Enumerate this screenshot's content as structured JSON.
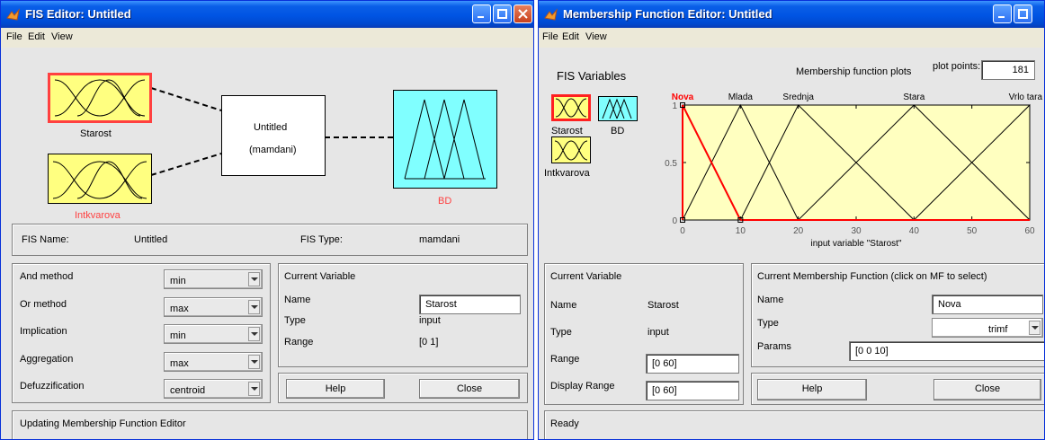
{
  "fis_editor": {
    "title": "FIS Editor: Untitled",
    "menu": [
      "File",
      "Edit",
      "View"
    ],
    "diagram": {
      "input1_label": "Starost",
      "input2_label": "Intkvarova",
      "system_name": "Untitled",
      "system_type": "(mamdani)",
      "output_label": "BD"
    },
    "info": {
      "fis_name_label": "FIS Name:",
      "fis_name_value": "Untitled",
      "fis_type_label": "FIS Type:",
      "fis_type_value": "mamdani"
    },
    "methods": [
      {
        "label": "And method",
        "value": "min"
      },
      {
        "label": "Or method",
        "value": "max"
      },
      {
        "label": "Implication",
        "value": "min"
      },
      {
        "label": "Aggregation",
        "value": "max"
      },
      {
        "label": "Defuzzification",
        "value": "centroid"
      }
    ],
    "current_variable": {
      "heading": "Current Variable",
      "name_label": "Name",
      "name_value": "Starost",
      "type_label": "Type",
      "type_value": "input",
      "range_label": "Range",
      "range_value": "[0 1]"
    },
    "help_label": "Help",
    "close_label": "Close",
    "status": "Updating Membership Function Editor"
  },
  "mf_editor": {
    "title": "Membership Function Editor: Untitled",
    "menu": [
      "File",
      "Edit",
      "View"
    ],
    "fis_variables_label": "FIS Variables",
    "variables": [
      "Starost",
      "BD",
      "Intkvarova"
    ],
    "plot_title": "Membership function plots",
    "plot_points_label": "plot points:",
    "plot_points_value": "181",
    "chart_data": {
      "type": "line",
      "xlabel": "input variable \"Starost\"",
      "xlim": [
        0,
        60
      ],
      "ylim": [
        0,
        1
      ],
      "x_ticks": [
        "0",
        "10",
        "20",
        "30",
        "40",
        "50",
        "60"
      ],
      "y_ticks": [
        "0",
        "0.5",
        "1"
      ],
      "series": [
        {
          "name": "Nova",
          "x": [
            0,
            0,
            10
          ],
          "y": [
            0,
            1,
            0
          ],
          "selected": true,
          "color": "#ff0000"
        },
        {
          "name": "Mlada",
          "x": [
            0,
            10,
            20
          ],
          "y": [
            0,
            1,
            0
          ],
          "color": "#000000"
        },
        {
          "name": "Srednja",
          "x": [
            10,
            20,
            40
          ],
          "y": [
            0,
            1,
            0
          ],
          "color": "#000000"
        },
        {
          "name": "Stara",
          "x": [
            20,
            40,
            60
          ],
          "y": [
            0,
            1,
            0
          ],
          "color": "#000000"
        },
        {
          "name": "Vrlo tara",
          "x": [
            40,
            60,
            60
          ],
          "y": [
            0,
            1,
            0
          ],
          "color": "#000000"
        }
      ],
      "label_x": [
        0,
        10,
        20,
        40,
        60
      ]
    },
    "current_variable": {
      "heading": "Current Variable",
      "name_label": "Name",
      "name_value": "Starost",
      "type_label": "Type",
      "type_value": "input",
      "range_label": "Range",
      "range_value": "[0 60]",
      "display_range_label": "Display Range",
      "display_range_value": "[0 60]"
    },
    "current_mf": {
      "heading": "Current Membership Function (click on MF to select)",
      "name_label": "Name",
      "name_value": "Nova",
      "type_label": "Type",
      "type_value": "trimf",
      "params_label": "Params",
      "params_value": "[0 0 10]"
    },
    "help_label": "Help",
    "close_label": "Close",
    "status": "Ready"
  }
}
